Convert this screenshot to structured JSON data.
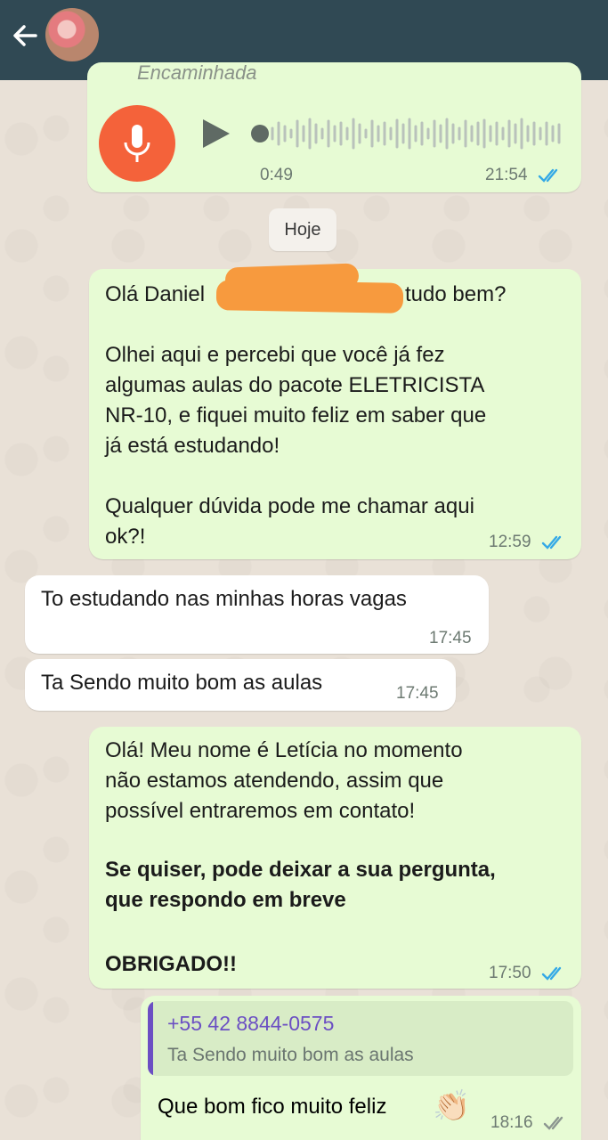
{
  "header": {
    "back_icon": "arrow-left-icon",
    "avatar": "contact-avatar"
  },
  "voice": {
    "forwarded_label": "Encaminhada",
    "duration": "0:49",
    "time": "21:54",
    "mic_icon": "microphone-icon",
    "play_icon": "play-icon"
  },
  "date_separator": "Hoje",
  "messages": [
    {
      "line1_start": "Olá Daniel",
      "line1_end": "tudo bem?",
      "body": "Olhei aqui e percebi que você já fez\nalgumas aulas do pacote ELETRICISTA\nNR-10, e fiquei muito feliz em saber que\njá está estudando!\n\nQualquer dúvida pode me chamar aqui\nok?!",
      "time": "12:59"
    },
    {
      "text": "To estudando nas minhas horas vagas",
      "time": "17:45"
    },
    {
      "text": "Ta Sendo muito bom as aulas",
      "time": "17:45"
    },
    {
      "text": "Olá! Meu nome é Letícia no momento\nnão estamos atendendo, assim que\npossível entraremos em contato!",
      "bold": "Se quiser, pode deixar a sua pergunta,\nque respondo em breve",
      "bold2": "OBRIGADO!!",
      "time": "17:50"
    },
    {
      "quote_number": "+55 42 8844-0575",
      "quote_text": "Ta Sendo muito bom as aulas",
      "text": "Que bom fico muito feliz",
      "emoji": "👏🏻",
      "time": "18:16"
    }
  ],
  "colors": {
    "header": "#304954",
    "outgoing": "#e7fbd4",
    "incoming": "#ffffff",
    "mic": "#f4623a",
    "ticks_read": "#34a9e6",
    "quote_name": "#6b4fc3"
  }
}
